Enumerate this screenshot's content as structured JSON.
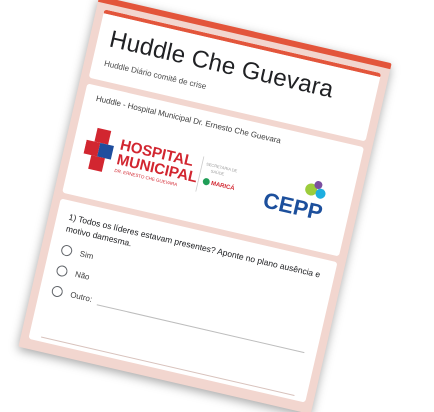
{
  "form": {
    "title": "Huddle Che Guevara",
    "description": "Huddle Diário comitê de crise",
    "accent_color": "#e3553b",
    "background_color": "#f2d6cf"
  },
  "header_section": {
    "caption": "Huddle - Hospital Municipal Dr. Ernesto Che Guevara",
    "hospital_logo": {
      "line1": "HOSPITAL",
      "line2": "MUNICIPAL",
      "line3": "DR. ERNESTO CHE GUEVARA",
      "secretaria_line1": "SECRETARIA DE",
      "secretaria_line2": "SAÚDE",
      "city": "MARICÁ"
    },
    "partner_logo": {
      "text": "CEPP"
    }
  },
  "question": {
    "text": "1) Todos os líderes estavam presentes? Aponte no plano ausência e motivo damesma.",
    "options": [
      {
        "label": "Sim"
      },
      {
        "label": "Não"
      },
      {
        "label": "Outro:"
      }
    ]
  }
}
